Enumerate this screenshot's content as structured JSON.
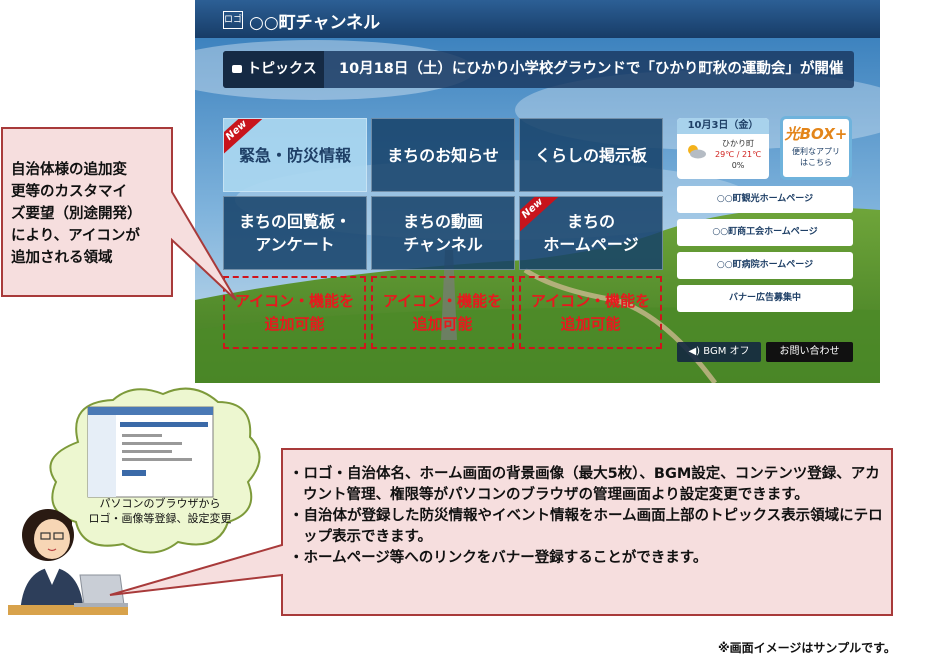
{
  "header": {
    "logo_label": "ロゴ",
    "title": "○○町チャンネル"
  },
  "topics": {
    "label": "トピックス",
    "text": "10月18日（土）にひかり小学校グラウンドで「ひかり町秋の運動会」が開催"
  },
  "tiles": [
    {
      "line1": "緊急・防災情報",
      "line2": "",
      "badge": "New"
    },
    {
      "line1": "まちのお知らせ",
      "line2": "",
      "badge": ""
    },
    {
      "line1": "くらしの掲示板",
      "line2": "",
      "badge": ""
    },
    {
      "line1": "まちの回覧板・",
      "line2": "アンケート",
      "badge": ""
    },
    {
      "line1": "まちの動画",
      "line2": "チャンネル",
      "badge": ""
    },
    {
      "line1": "まちの",
      "line2": "ホームページ",
      "badge": "New"
    }
  ],
  "add_slots": [
    {
      "line1": "アイコン・機能を",
      "line2": "追加可能"
    },
    {
      "line1": "アイコン・機能を",
      "line2": "追加可能"
    },
    {
      "line1": "アイコン・機能を",
      "line2": "追加可能"
    }
  ],
  "weather": {
    "date": "10月3日（金）",
    "town": "ひかり町",
    "temp": "29℃ / 21℃",
    "rain": "0%"
  },
  "hikari_box": {
    "brand": "光BOX+",
    "line1": "便利なアプリ",
    "line2": "はこちら"
  },
  "banners": [
    "○○町観光ホームページ",
    "○○町商工会ホームページ",
    "○○町病院ホームページ",
    "バナー広告募集中"
  ],
  "bgm_button": "BGM オフ",
  "contact_button": "お問い合わせ",
  "callout": {
    "lines": [
      "自治体様の追加変",
      "更等のカスタマイ",
      "ズ要望（別途開発）",
      "により、アイコンが",
      "追加される領域"
    ]
  },
  "cloud": {
    "line1": "パソコンのブラウザから",
    "line2": "ロゴ・画像等登録、設定変更"
  },
  "notes": [
    "・ロゴ・自治体名、ホーム画面の背景画像（最大5枚）、BGM設定、コンテンツ登録、アカウント管理、権限等がパソコンのブラウザの管理画面より設定変更できます。",
    "・自治体が登録した防災情報やイベント情報をホーム画面上部のトピックス表示領域にテロップ表示できます。",
    "・ホームページ等へのリンクをバナー登録することができます。"
  ],
  "footnote": "※画面イメージはサンプルです。",
  "colors": {
    "header": "#1f4b7d",
    "tile": "#16416a",
    "accent_red": "#e8181e",
    "callout_fill": "#f6dede",
    "callout_border": "#a83a3a"
  }
}
